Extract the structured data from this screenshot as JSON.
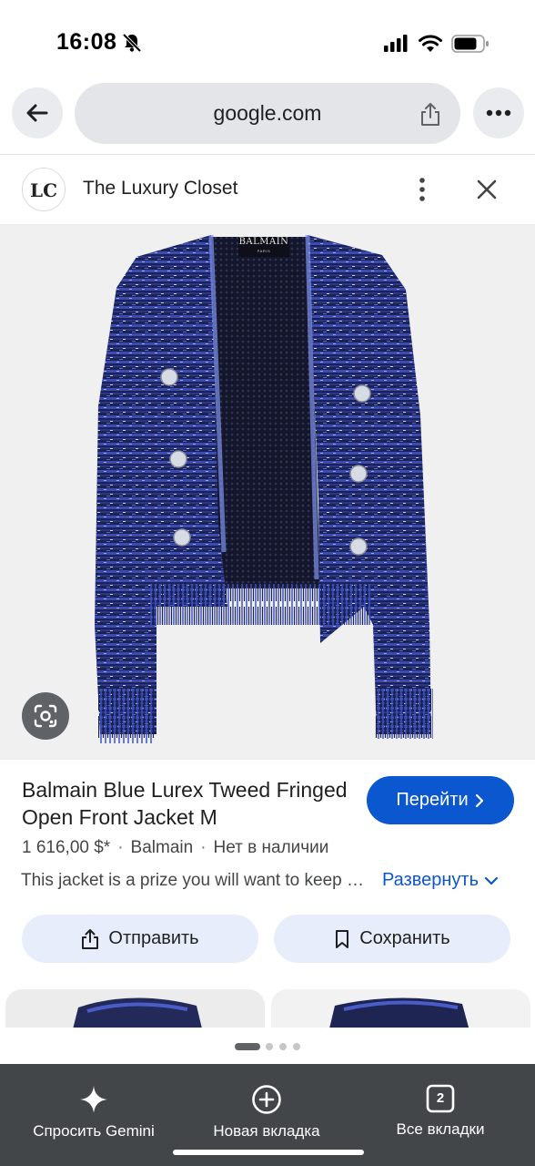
{
  "status_bar": {
    "time": "16:08",
    "icons": [
      "bell-slash-icon",
      "signal-icon",
      "wifi-icon",
      "battery-icon"
    ]
  },
  "browser": {
    "url": "google.com",
    "back_icon": "arrow-left-icon",
    "share_icon": "share-icon",
    "menu_icon": "more-horizontal-icon"
  },
  "source": {
    "logo_text": "LC",
    "name": "The Luxury Closet"
  },
  "image": {
    "brand_label": "BALMAIN",
    "brand_sublabel": "PARIS",
    "lens_icon": "google-lens-icon"
  },
  "product": {
    "title": "Balmain Blue Lurex Tweed Fringed Open Front Jacket M",
    "price": "1 616,00 $*",
    "brand": "Balmain",
    "availability": "Нет в наличии",
    "separator": "·",
    "snippet": "This jacket is a prize you will want to keep close",
    "visit_label": "Перейти",
    "expand_label": "Развернуть"
  },
  "actions": {
    "share_label": "Отправить",
    "save_label": "Сохранить"
  },
  "carousel": {
    "pages": 4,
    "active": 0
  },
  "bottom_bar": {
    "gemini_label": "Спросить Gemini",
    "new_tab_label": "Новая вкладка",
    "tabs_label": "Все вкладки",
    "tab_count": "2"
  },
  "colors": {
    "accent": "#0b57d0",
    "chip_bg": "#e7edfb",
    "toolbar_bg": "#434648",
    "jacket_blue": "#2b3a8f"
  }
}
